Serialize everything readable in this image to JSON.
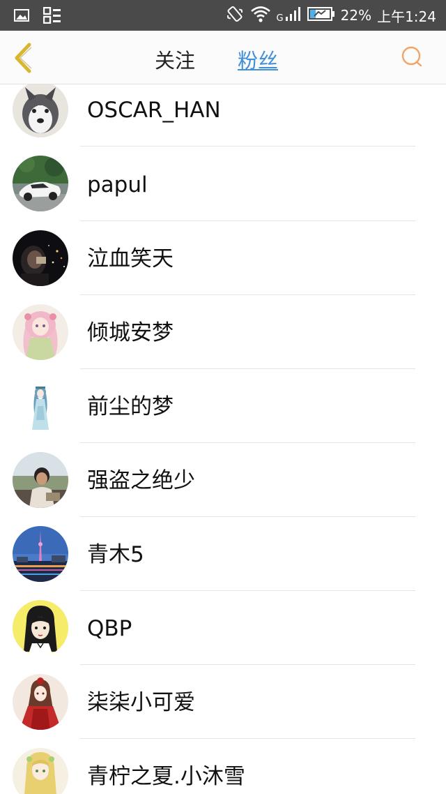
{
  "status_bar": {
    "battery_text": "22%",
    "time_text": "上午1:24",
    "network_label": "G",
    "icons": [
      "image-icon",
      "qr-menu-icon",
      "vibrate-icon",
      "wifi-icon",
      "signal-icon",
      "battery-icon"
    ]
  },
  "nav": {
    "back_icon": "chevron-left-icon",
    "tab_following": "关注",
    "tab_fans": "粉丝",
    "search_icon": "search-icon",
    "colors": {
      "back": "#d8b62e",
      "active_tab": "#3f8fd9",
      "search": "#f0a468"
    }
  },
  "fans": [
    {
      "name": "OSCAR_HAN",
      "avatar": "husky-puppy"
    },
    {
      "name": "papul",
      "avatar": "white-sports-car"
    },
    {
      "name": "泣血笑天",
      "avatar": "night-city-person"
    },
    {
      "name": "倾城安梦",
      "avatar": "anime-pink-girl"
    },
    {
      "name": "前尘的梦",
      "avatar": "anime-blue-girl"
    },
    {
      "name": "强盗之绝少",
      "avatar": "young-man-photo"
    },
    {
      "name": "青木5",
      "avatar": "tv-tower-night"
    },
    {
      "name": "QBP",
      "avatar": "cartoon-girl-yellow"
    },
    {
      "name": "柒柒小可爱",
      "avatar": "anime-red-girl"
    },
    {
      "name": "青柠之夏.小沐雪",
      "avatar": "anime-blonde-girl"
    }
  ]
}
